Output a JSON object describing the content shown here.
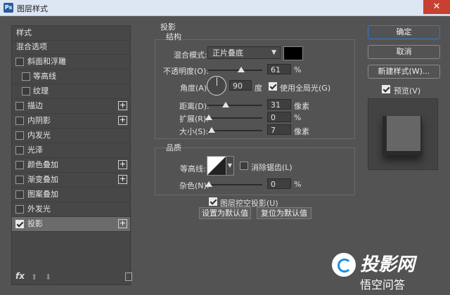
{
  "window": {
    "title": "图层样式",
    "close_glyph": "✕"
  },
  "sidebar": {
    "items": [
      {
        "label": "样式",
        "checkbox": false,
        "checked": false,
        "plus": false,
        "indent": false,
        "selected": false
      },
      {
        "label": "混合选项",
        "checkbox": false,
        "checked": false,
        "plus": false,
        "indent": false,
        "selected": false
      },
      {
        "label": "斜面和浮雕",
        "checkbox": true,
        "checked": false,
        "plus": false,
        "indent": false,
        "selected": false
      },
      {
        "label": "等高线",
        "checkbox": true,
        "checked": false,
        "plus": false,
        "indent": true,
        "selected": false
      },
      {
        "label": "纹理",
        "checkbox": true,
        "checked": false,
        "plus": false,
        "indent": true,
        "selected": false
      },
      {
        "label": "描边",
        "checkbox": true,
        "checked": false,
        "plus": true,
        "indent": false,
        "selected": false
      },
      {
        "label": "内阴影",
        "checkbox": true,
        "checked": false,
        "plus": true,
        "indent": false,
        "selected": false
      },
      {
        "label": "内发光",
        "checkbox": true,
        "checked": false,
        "plus": false,
        "indent": false,
        "selected": false
      },
      {
        "label": "光泽",
        "checkbox": true,
        "checked": false,
        "plus": false,
        "indent": false,
        "selected": false
      },
      {
        "label": "颜色叠加",
        "checkbox": true,
        "checked": false,
        "plus": true,
        "indent": false,
        "selected": false
      },
      {
        "label": "渐变叠加",
        "checkbox": true,
        "checked": false,
        "plus": true,
        "indent": false,
        "selected": false
      },
      {
        "label": "图案叠加",
        "checkbox": true,
        "checked": false,
        "plus": false,
        "indent": false,
        "selected": false
      },
      {
        "label": "外发光",
        "checkbox": true,
        "checked": false,
        "plus": false,
        "indent": false,
        "selected": false
      },
      {
        "label": "投影",
        "checkbox": true,
        "checked": true,
        "plus": true,
        "indent": false,
        "selected": true
      }
    ],
    "fx_label": "fx",
    "up_glyph": "⬆",
    "down_glyph": "⬇"
  },
  "section": {
    "title": "投影"
  },
  "structure": {
    "title": "结构",
    "blend_mode_label": "混合模式:",
    "blend_mode_value": "正片叠底",
    "blend_color": "#000000",
    "opacity_label": "不透明度(O):",
    "opacity_value": "61",
    "opacity_unit": "%",
    "opacity_level": 0.61,
    "angle_label": "角度(A):",
    "angle_value": "90",
    "angle_unit": "度",
    "global_light_label": "使用全局光(G)",
    "global_light_checked": true,
    "distance_label": "距离(D):",
    "distance_value": "31",
    "distance_unit": "像素",
    "spread_label": "扩展(R):",
    "spread_value": "0",
    "spread_unit": "%",
    "size_label": "大小(S):",
    "size_value": "7",
    "size_unit": "像素"
  },
  "quality": {
    "title": "品质",
    "contour_label": "等高线:",
    "antialias_label": "消除锯齿(L)",
    "antialias_checked": false,
    "noise_label": "杂色(N):",
    "noise_value": "0",
    "noise_unit": "%"
  },
  "knockout": {
    "label": "图层挖空投影(U)",
    "checked": true
  },
  "buttons": {
    "make_default": "设置为默认值",
    "reset_default": "复位为默认值",
    "ok": "确定",
    "cancel": "取消",
    "new_style": "新建样式(W)...",
    "preview_label": "预览(V)",
    "preview_checked": true
  },
  "watermark": {
    "line1": "投影网",
    "line2": "悟空问答"
  },
  "colors": {
    "accent": "#2f7be0",
    "panel_bg": "#535353",
    "selected_item": "#6b6b6b"
  }
}
